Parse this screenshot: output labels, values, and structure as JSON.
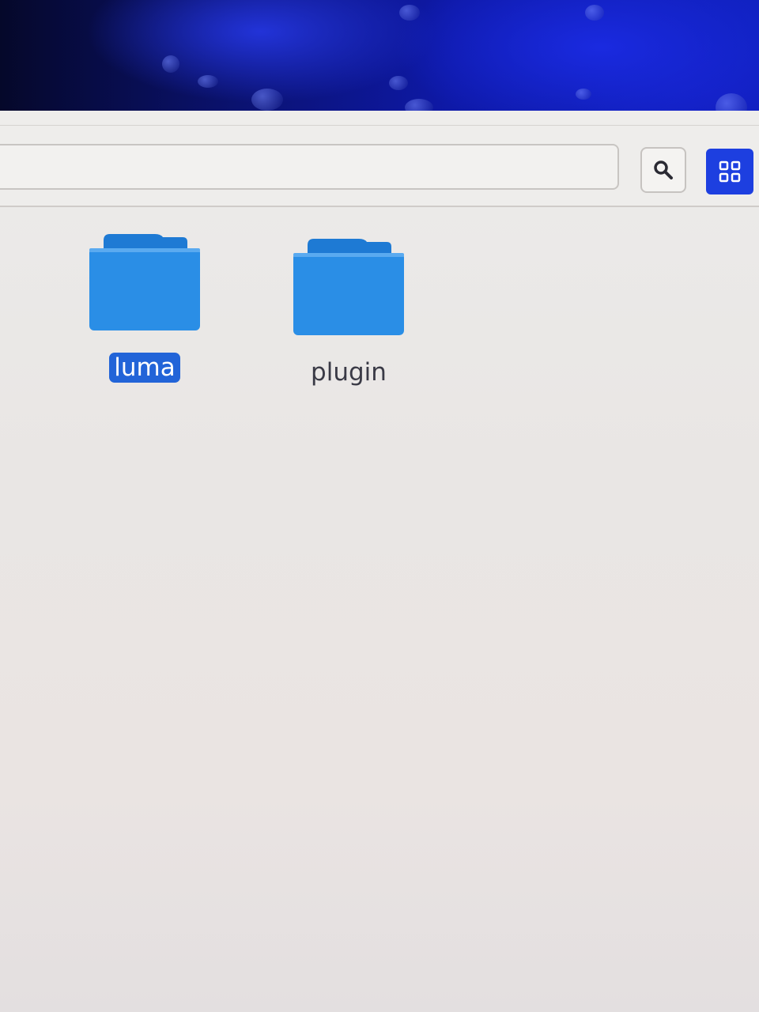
{
  "toolbar": {
    "search_icon": "search-icon",
    "view_icon": "grid-view-icon"
  },
  "files": [
    {
      "name": "luma",
      "icon": "folder-icon",
      "selected": true
    },
    {
      "name": "plugin",
      "icon": "folder-icon",
      "selected": false
    }
  ],
  "colors": {
    "folder": "#2a8ee6",
    "folder_shade": "#1e7ad4",
    "selection": "#2264d8",
    "view_button": "#1d3fe0",
    "wallpaper": "#0e19a8"
  }
}
